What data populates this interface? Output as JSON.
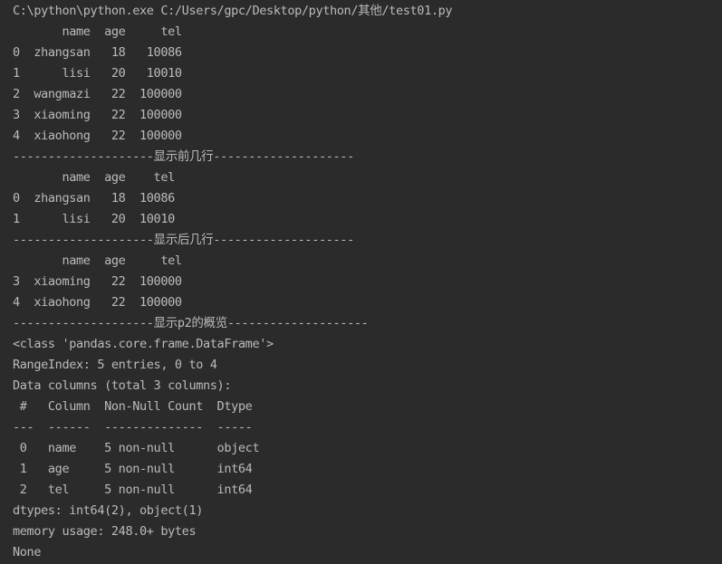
{
  "console": {
    "lines": [
      "C:\\python\\python.exe C:/Users/gpc/Desktop/python/其他/test01.py",
      "       name  age     tel",
      "0  zhangsan   18   10086",
      "1      lisi   20   10010",
      "2  wangmazi   22  100000",
      "3  xiaoming   22  100000",
      "4  xiaohong   22  100000",
      "--------------------显示前几行--------------------",
      "       name  age    tel",
      "0  zhangsan   18  10086",
      "1      lisi   20  10010",
      "--------------------显示后几行--------------------",
      "       name  age     tel",
      "3  xiaoming   22  100000",
      "4  xiaohong   22  100000",
      "--------------------显示p2的概览--------------------",
      "<class 'pandas.core.frame.DataFrame'>",
      "RangeIndex: 5 entries, 0 to 4",
      "Data columns (total 3 columns):",
      " #   Column  Non-Null Count  Dtype ",
      "---  ------  --------------  ----- ",
      " 0   name    5 non-null      object",
      " 1   age     5 non-null      int64 ",
      " 2   tel     5 non-null      int64 ",
      "dtypes: int64(2), object(1)",
      "memory usage: 248.0+ bytes",
      "None"
    ]
  }
}
